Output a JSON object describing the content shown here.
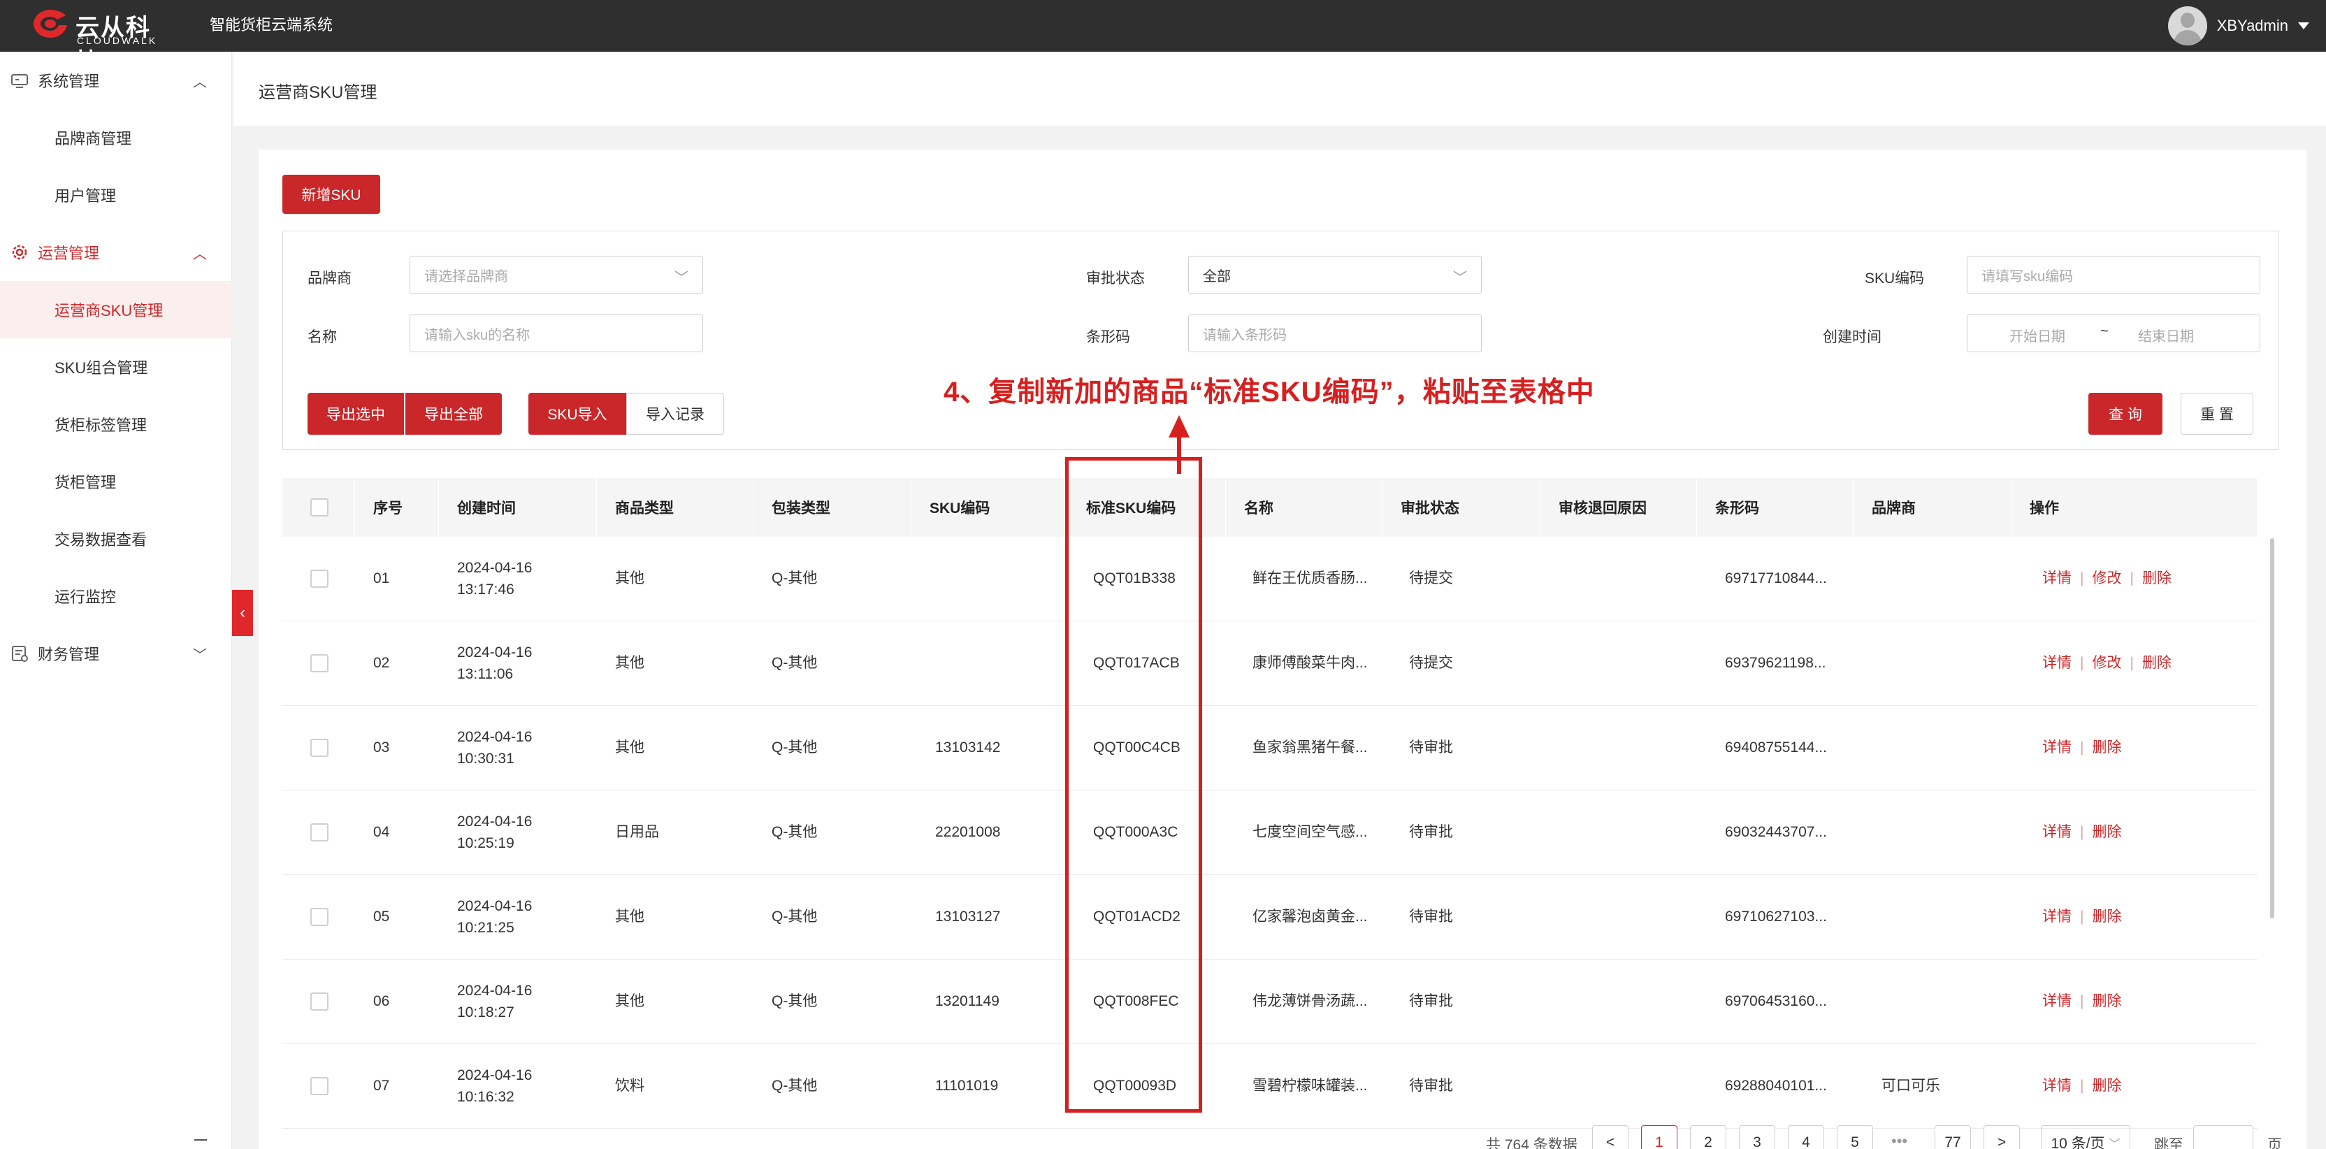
{
  "app": {
    "logo_cn": "云从科技",
    "logo_en": "CLOUDWALK",
    "system_title": "智能货柜云端系统",
    "username": "XBYadmin"
  },
  "sidebar": {
    "groups": [
      {
        "label": "系统管理",
        "icon": "monitor-icon",
        "expanded": true,
        "items": [
          "品牌商管理",
          "用户管理"
        ]
      },
      {
        "label": "运营管理",
        "icon": "gear-icon",
        "expanded": true,
        "items": [
          "运营商SKU管理",
          "SKU组合管理",
          "货柜标签管理",
          "货柜管理",
          "交易数据查看",
          "运行监控"
        ]
      },
      {
        "label": "财务管理",
        "icon": "finance-icon",
        "expanded": false,
        "items": []
      }
    ],
    "selected_item": "运营商SKU管理",
    "collapse_glyph": "‹"
  },
  "page": {
    "title": "运营商SKU管理"
  },
  "toolbar": {
    "add_sku": "新增SKU"
  },
  "filters": {
    "brand_label": "品牌商",
    "brand_placeholder": "请选择品牌商",
    "status_label": "审批状态",
    "status_value": "全部",
    "sku_code_label": "SKU编码",
    "sku_code_placeholder": "请填写sku编码",
    "name_label": "名称",
    "name_placeholder": "请输入sku的名称",
    "barcode_label": "条形码",
    "barcode_placeholder": "请输入条形码",
    "created_label": "创建时间",
    "start_placeholder": "开始日期",
    "date_separator": "~",
    "end_placeholder": "结束日期"
  },
  "actions": {
    "export_selected": "导出选中",
    "export_all": "导出全部",
    "sku_import": "SKU导入",
    "import_records": "导入记录",
    "query": "查 询",
    "reset": "重 置"
  },
  "annotation": {
    "text": "4、复制新加的商品“标准SKU编码”，粘贴至表格中",
    "color": "#d6201f"
  },
  "table": {
    "headers": [
      "序号",
      "创建时间",
      "商品类型",
      "包装类型",
      "SKU编码",
      "标准SKU编码",
      "名称",
      "审批状态",
      "审核退回原因",
      "条形码",
      "品牌商",
      "操作"
    ],
    "rows": [
      {
        "no": "01",
        "date": "2024-04-16",
        "time": "13:17:46",
        "type": "其他",
        "pack": "Q-其他",
        "sku": "",
        "std_sku": "QQT01B338",
        "name": "鲜在王优质香肠...",
        "status": "待提交",
        "reason": "",
        "barcode": "69717710844...",
        "brand": "",
        "ops": [
          "详情",
          "修改",
          "删除"
        ]
      },
      {
        "no": "02",
        "date": "2024-04-16",
        "time": "13:11:06",
        "type": "其他",
        "pack": "Q-其他",
        "sku": "",
        "std_sku": "QQT017ACB",
        "name": "康师傅酸菜牛肉...",
        "status": "待提交",
        "reason": "",
        "barcode": "69379621198...",
        "brand": "",
        "ops": [
          "详情",
          "修改",
          "删除"
        ]
      },
      {
        "no": "03",
        "date": "2024-04-16",
        "time": "10:30:31",
        "type": "其他",
        "pack": "Q-其他",
        "sku": "13103142",
        "std_sku": "QQT00C4CB",
        "name": "鱼家翁黑猪午餐...",
        "status": "待审批",
        "reason": "",
        "barcode": "69408755144...",
        "brand": "",
        "ops": [
          "详情",
          "删除"
        ]
      },
      {
        "no": "04",
        "date": "2024-04-16",
        "time": "10:25:19",
        "type": "日用品",
        "pack": "Q-其他",
        "sku": "22201008",
        "std_sku": "QQT000A3C",
        "name": "七度空间空气感...",
        "status": "待审批",
        "reason": "",
        "barcode": "69032443707...",
        "brand": "",
        "ops": [
          "详情",
          "删除"
        ]
      },
      {
        "no": "05",
        "date": "2024-04-16",
        "time": "10:21:25",
        "type": "其他",
        "pack": "Q-其他",
        "sku": "13103127",
        "std_sku": "QQT01ACD2",
        "name": "亿家馨泡卤黄金...",
        "status": "待审批",
        "reason": "",
        "barcode": "69710627103...",
        "brand": "",
        "ops": [
          "详情",
          "删除"
        ]
      },
      {
        "no": "06",
        "date": "2024-04-16",
        "time": "10:18:27",
        "type": "其他",
        "pack": "Q-其他",
        "sku": "13201149",
        "std_sku": "QQT008FEC",
        "name": "伟龙薄饼骨汤蔬...",
        "status": "待审批",
        "reason": "",
        "barcode": "69706453160...",
        "brand": "",
        "ops": [
          "详情",
          "删除"
        ]
      },
      {
        "no": "07",
        "date": "2024-04-16",
        "time": "10:16:32",
        "type": "饮料",
        "pack": "Q-其他",
        "sku": "11101019",
        "std_sku": "QQT00093D",
        "name": "雪碧柠檬味罐装...",
        "status": "待审批",
        "reason": "",
        "barcode": "69288040101...",
        "brand": "可口可乐",
        "ops": [
          "详情",
          "删除"
        ]
      }
    ]
  },
  "pagination": {
    "total": "共 764 条数据",
    "prev": "<",
    "pages": [
      "1",
      "2",
      "3",
      "4",
      "5"
    ],
    "active": "1",
    "ellipsis": "•••",
    "last": "77",
    "next": ">",
    "page_size": "10 条/页",
    "jump_label": "跳至",
    "page_suffix": "页"
  },
  "colors": {
    "brand_red": "#c9272a",
    "topbar": "#2f2f2f",
    "annotation_red": "#d6201f"
  }
}
